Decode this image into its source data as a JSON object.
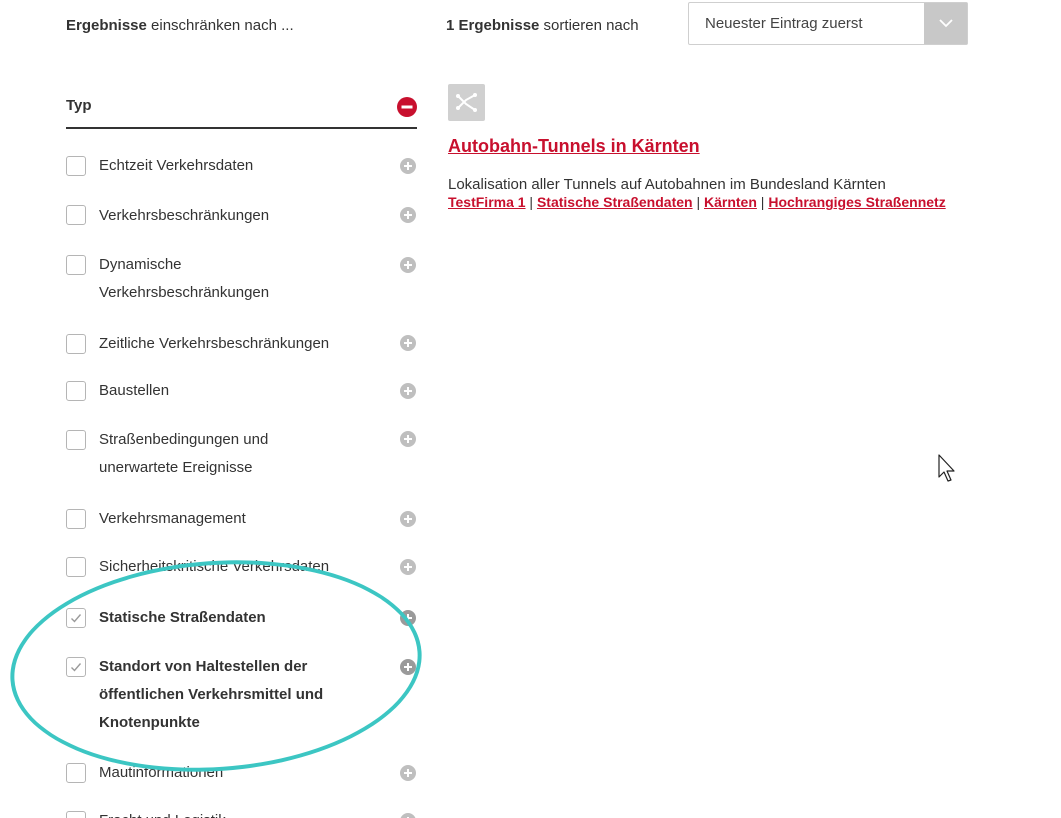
{
  "header": {
    "filter_bold": "Ergebnisse",
    "filter_rest": " einschränken nach ...",
    "results_bold": "1 Ergebnisse",
    "results_rest": " sortieren nach",
    "sort_selected": "Neuester Eintrag zuerst"
  },
  "facet": {
    "title": "Typ",
    "items": [
      {
        "line1": "Echtzeit Verkehrsdaten",
        "line2": "",
        "line3": "",
        "checked": false
      },
      {
        "line1": "Verkehrsbeschränkungen",
        "line2": "",
        "line3": "",
        "checked": false
      },
      {
        "line1": "Dynamische",
        "line2": "Verkehrsbeschränkungen",
        "line3": "",
        "checked": false
      },
      {
        "line1": "Zeitliche Verkehrsbeschränkungen",
        "line2": "",
        "line3": "",
        "checked": false
      },
      {
        "line1": "Baustellen",
        "line2": "",
        "line3": "",
        "checked": false
      },
      {
        "line1": "Straßenbedingungen und",
        "line2": "unerwartete Ereignisse",
        "line3": "",
        "checked": false
      },
      {
        "line1": "Verkehrsmanagement",
        "line2": "",
        "line3": "",
        "checked": false
      },
      {
        "line1": "Sicherheitskritische Verkehrsdaten",
        "line2": "",
        "line3": "",
        "checked": false
      },
      {
        "line1": "Statische Straßendaten",
        "line2": "",
        "line3": "",
        "checked": true
      },
      {
        "line1": "Standort von Haltestellen der",
        "line2": "öffentlichen Verkehrsmittel und",
        "line3": "Knotenpunkte",
        "checked": true
      },
      {
        "line1": "Mautinformationen",
        "line2": "",
        "line3": "",
        "checked": false
      },
      {
        "line1": "Fracht und Logistik",
        "line2": "",
        "line3": "",
        "checked": false
      }
    ]
  },
  "result": {
    "title": "Autobahn-Tunnels in Kärnten",
    "description": "Lokalisation aller Tunnels auf Autobahnen im Bundesland Kärnten",
    "tags": [
      "TestFirma 1",
      "Statische Straßendaten",
      "Kärnten",
      "Hochrangiges Straßennetz"
    ],
    "separator": " | "
  },
  "colors": {
    "accent": "#c8102e",
    "highlight": "#3cc6c3",
    "muted": "#c8c8c8"
  }
}
